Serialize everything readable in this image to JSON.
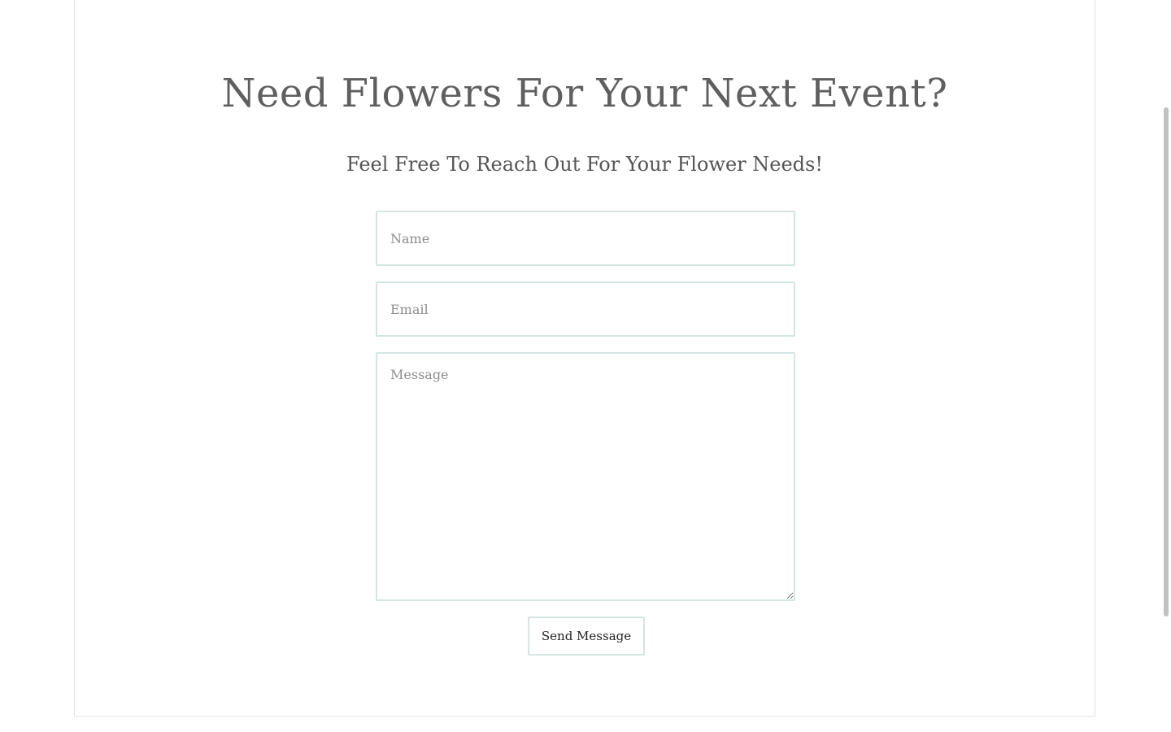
{
  "contact": {
    "heading": "Need Flowers For Your Next Event?",
    "subheading": "Feel Free To Reach Out For Your Flower Needs!",
    "name_placeholder": "Name",
    "email_placeholder": "Email",
    "message_placeholder": "Message",
    "send_label": "Send Message"
  },
  "colors": {
    "heading": "#5f5f5f",
    "field_border": "#d4e6e3",
    "card_border": "#e2e2e2"
  }
}
